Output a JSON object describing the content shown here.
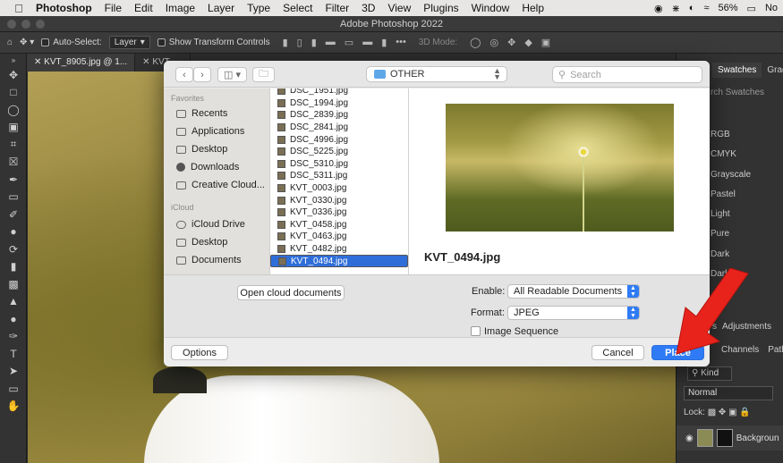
{
  "menubar": {
    "app_name": "Photoshop",
    "items": [
      "File",
      "Edit",
      "Image",
      "Layer",
      "Type",
      "Select",
      "Filter",
      "3D",
      "View",
      "Plugins",
      "Window",
      "Help"
    ],
    "battery": "56%",
    "user": "No"
  },
  "window": {
    "title": "Adobe Photoshop 2022"
  },
  "optionsbar": {
    "auto_select_label": "Auto-Select:",
    "auto_select_value": "Layer",
    "show_transform_label": "Show Transform Controls",
    "mode_3d": "3D Mode:"
  },
  "doc_tabs": [
    "KVT_8905.jpg @ 1...",
    "KVT_..."
  ],
  "right_panel": {
    "tabs": [
      "Swatches",
      "Gradi"
    ],
    "search_placeholder": "rch Swatches",
    "swatch_groups": [
      "RGB",
      "CMYK",
      "Grayscale",
      "Pastel",
      "Light",
      "Pure",
      "Dark",
      "Darker"
    ],
    "layers_tabs": [
      "s",
      "Adjustments"
    ],
    "layers_subtabs": [
      "Channels",
      "Path"
    ],
    "kind": "Kind",
    "blend_mode": "Normal",
    "lock_label": "Lock:",
    "layer_name": "Backgroun"
  },
  "dialog": {
    "location": "OTHER",
    "search_placeholder": "Search",
    "favorites_header": "Favorites",
    "favorites": [
      "Recents",
      "Applications",
      "Desktop",
      "Downloads",
      "Creative Cloud..."
    ],
    "icloud_header": "iCloud",
    "icloud": [
      "iCloud Drive",
      "Desktop",
      "Documents"
    ],
    "files": [
      "DSC_1951.jpg",
      "DSC_1994.jpg",
      "DSC_2839.jpg",
      "DSC_2841.jpg",
      "DSC_4996.jpg",
      "DSC_5225.jpg",
      "DSC_5310.jpg",
      "DSC_5311.jpg",
      "KVT_0003.jpg",
      "KVT_0330.jpg",
      "KVT_0336.jpg",
      "KVT_0458.jpg",
      "KVT_0463.jpg",
      "KVT_0482.jpg",
      "KVT_0494.jpg"
    ],
    "selected_file": "KVT_0494.jpg",
    "preview_name": "KVT_0494.jpg",
    "open_cloud_label": "Open cloud documents",
    "enable_label": "Enable:",
    "enable_value": "All Readable Documents",
    "format_label": "Format:",
    "format_value": "JPEG",
    "image_sequence_label": "Image Sequence",
    "options_label": "Options",
    "cancel_label": "Cancel",
    "place_label": "Place"
  },
  "colors": {
    "accent": "#2f7bf5",
    "arrow": "#e8231c"
  }
}
